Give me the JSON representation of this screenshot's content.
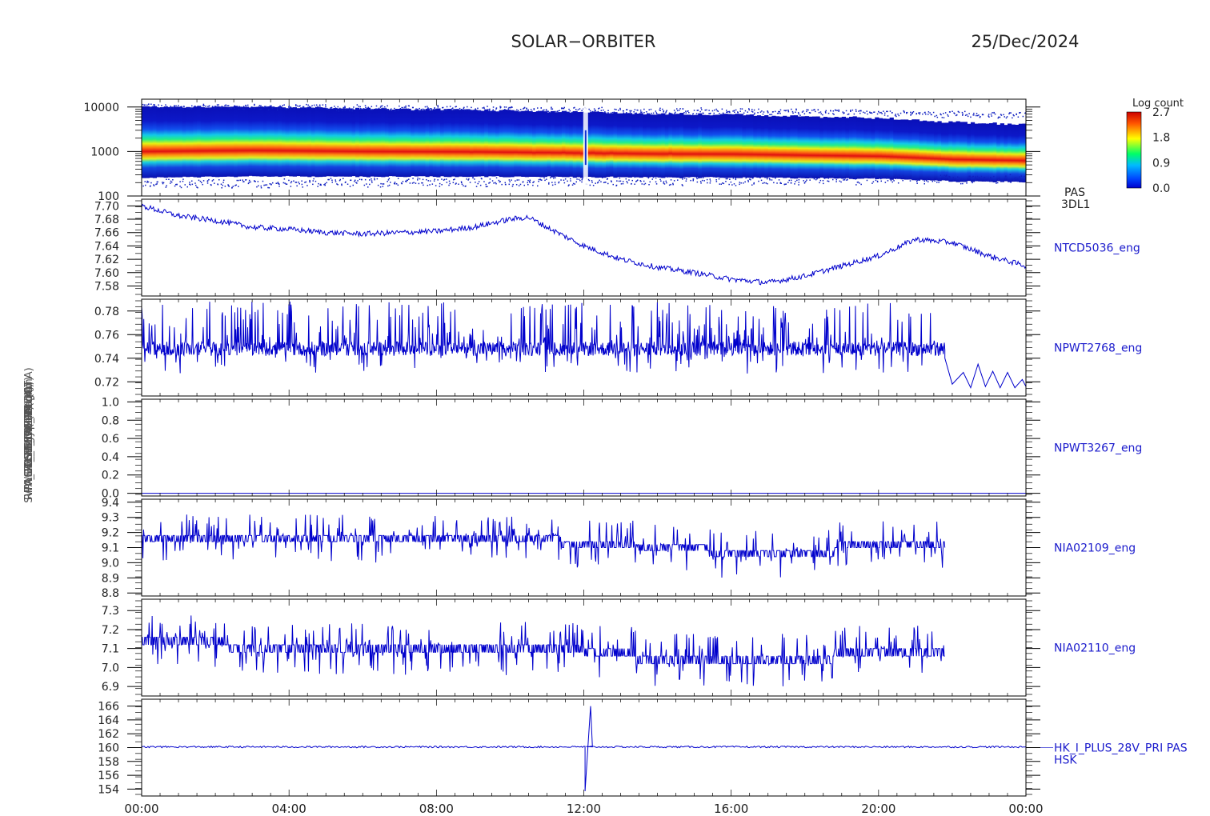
{
  "header": {
    "mission": "SOLAR−ORBITER",
    "date": "25/Dec/2024"
  },
  "colors": {
    "line": "#0000cc",
    "label": "#1a1acc",
    "axis": "#000000"
  },
  "x_axis": {
    "ticks": [
      "00:00",
      "04:00",
      "08:00",
      "12:00",
      "16:00",
      "20:00",
      "00:00"
    ],
    "range_hours": [
      0,
      24
    ]
  },
  "colorbar": {
    "title": "Log count",
    "ticks": [
      "2.7",
      "1.8",
      "0.9",
      "0.0"
    ],
    "range": [
      0.0,
      2.7
    ]
  },
  "ylabels_stack": [
    "PAS Energy (eV)",
    "SWA_EAS Temp (DegC)",
    "RPW TDS FSW DPU (uT)",
    "CAL V2C0 1 MCA",
    "HK_THERM 2 (mA)",
    "LIB_ThERM (V)",
    "HK_IMON_PDU (mA)"
  ],
  "chart_data": [
    {
      "type": "heatmap",
      "panel": "PAS 3DL1",
      "side_label": [
        "PAS",
        "3DL1"
      ],
      "ylabel": "Energy (eV)",
      "yscale": "log",
      "ylim": [
        100,
        15000
      ],
      "y_ticks": [
        "10000",
        "1000",
        "100"
      ],
      "y_tick_values": [
        10000,
        1000,
        100
      ],
      "peak_energy_eV": [
        [
          0,
          1000
        ],
        [
          3,
          1050
        ],
        [
          6,
          1000
        ],
        [
          9,
          980
        ],
        [
          11,
          940
        ],
        [
          12,
          920
        ],
        [
          14,
          880
        ],
        [
          16,
          870
        ],
        [
          18,
          820
        ],
        [
          20,
          780
        ],
        [
          22,
          660
        ],
        [
          24,
          620
        ]
      ],
      "data_gap_hour": 12.05
    },
    {
      "type": "line",
      "panel": "NTCD5036_eng",
      "side_label": "NTCD5036_eng",
      "ylim": [
        7.565,
        7.71
      ],
      "y_ticks": [
        "7.70",
        "7.68",
        "7.66",
        "7.64",
        "7.62",
        "7.60",
        "7.58"
      ],
      "y_tick_values": [
        7.7,
        7.68,
        7.66,
        7.64,
        7.62,
        7.6,
        7.58
      ],
      "points": [
        [
          0,
          7.7
        ],
        [
          1,
          7.685
        ],
        [
          2,
          7.678
        ],
        [
          3,
          7.668
        ],
        [
          4,
          7.665
        ],
        [
          5,
          7.66
        ],
        [
          6,
          7.658
        ],
        [
          7,
          7.66
        ],
        [
          8,
          7.662
        ],
        [
          9,
          7.668
        ],
        [
          10,
          7.68
        ],
        [
          10.5,
          7.683
        ],
        [
          11,
          7.668
        ],
        [
          12,
          7.64
        ],
        [
          13,
          7.62
        ],
        [
          14,
          7.608
        ],
        [
          15,
          7.6
        ],
        [
          16,
          7.59
        ],
        [
          17,
          7.585
        ],
        [
          18,
          7.595
        ],
        [
          19,
          7.61
        ],
        [
          20,
          7.625
        ],
        [
          21,
          7.65
        ],
        [
          22,
          7.645
        ],
        [
          23,
          7.625
        ],
        [
          24,
          7.61
        ]
      ],
      "noise": 0.004
    },
    {
      "type": "line",
      "panel": "NPWT2768_eng",
      "side_label": "NPWT2768_eng",
      "ylim": [
        0.708,
        0.79
      ],
      "y_ticks": [
        "0.78",
        "0.76",
        "0.74",
        "0.72"
      ],
      "y_tick_values": [
        0.78,
        0.76,
        0.74,
        0.72
      ],
      "baseline": 0.748,
      "spike_high": 0.788,
      "spike_low": 0.727,
      "noisy_until_hour": 21.8,
      "tail_points": [
        [
          21.8,
          0.74
        ],
        [
          22.0,
          0.718
        ],
        [
          22.3,
          0.728
        ],
        [
          22.5,
          0.715
        ],
        [
          22.7,
          0.735
        ],
        [
          22.9,
          0.716
        ],
        [
          23.1,
          0.729
        ],
        [
          23.3,
          0.715
        ],
        [
          23.5,
          0.728
        ],
        [
          23.7,
          0.715
        ],
        [
          23.9,
          0.722
        ],
        [
          24.0,
          0.716
        ]
      ]
    },
    {
      "type": "line",
      "panel": "NPWT3267_eng",
      "side_label": "NPWT3267_eng",
      "ylim": [
        -0.03,
        1.03
      ],
      "y_ticks": [
        "1.0",
        "0.8",
        "0.6",
        "0.4",
        "0.2",
        "0.0"
      ],
      "y_tick_values": [
        1.0,
        0.8,
        0.6,
        0.4,
        0.2,
        0.0
      ],
      "points": [
        [
          0,
          0.0
        ],
        [
          24,
          0.0
        ]
      ]
    },
    {
      "type": "line",
      "panel": "NIA02109_eng",
      "side_label": "NIA02109_eng",
      "ylim": [
        8.78,
        9.42
      ],
      "y_ticks": [
        "9.4",
        "9.3",
        "9.2",
        "9.1",
        "9.0",
        "8.9",
        "8.8"
      ],
      "y_tick_values": [
        9.4,
        9.3,
        9.2,
        9.1,
        9.0,
        8.9,
        8.8
      ],
      "levels": [
        [
          0,
          9.16
        ],
        [
          11.4,
          9.12
        ],
        [
          13.4,
          9.1
        ],
        [
          15.4,
          9.06
        ],
        [
          18.8,
          9.12
        ],
        [
          21.8,
          9.12
        ]
      ],
      "spike_amplitude": 0.16,
      "data_end_hour": 21.8
    },
    {
      "type": "line",
      "panel": "NIA02110_eng",
      "side_label": "NIA02110_eng",
      "ylim": [
        6.85,
        7.36
      ],
      "y_ticks": [
        "7.3",
        "7.2",
        "7.1",
        "7.0",
        "6.9"
      ],
      "y_tick_values": [
        7.3,
        7.2,
        7.1,
        7.0,
        6.9
      ],
      "levels": [
        [
          0,
          7.14
        ],
        [
          2.2,
          7.1
        ],
        [
          12.0,
          7.08
        ],
        [
          13.4,
          7.04
        ],
        [
          15.6,
          7.04
        ],
        [
          18.8,
          7.08
        ],
        [
          21.8,
          7.08
        ]
      ],
      "spike_amplitude": 0.14,
      "data_end_hour": 21.8
    },
    {
      "type": "line",
      "panel": "HK_I_PLUS_28V_PRI PAS HSK",
      "side_label": [
        "HK_I_PLUS_28V_PRI PAS",
        "HSK"
      ],
      "ylim": [
        153,
        167
      ],
      "y_ticks": [
        "166",
        "164",
        "162",
        "160",
        "158",
        "156",
        "154"
      ],
      "y_tick_values": [
        166,
        164,
        162,
        160,
        158,
        156,
        154
      ],
      "baseline": 160.1,
      "spike_hour": 12.05,
      "spike_min": 153.7,
      "spike_max": 166.0
    }
  ]
}
